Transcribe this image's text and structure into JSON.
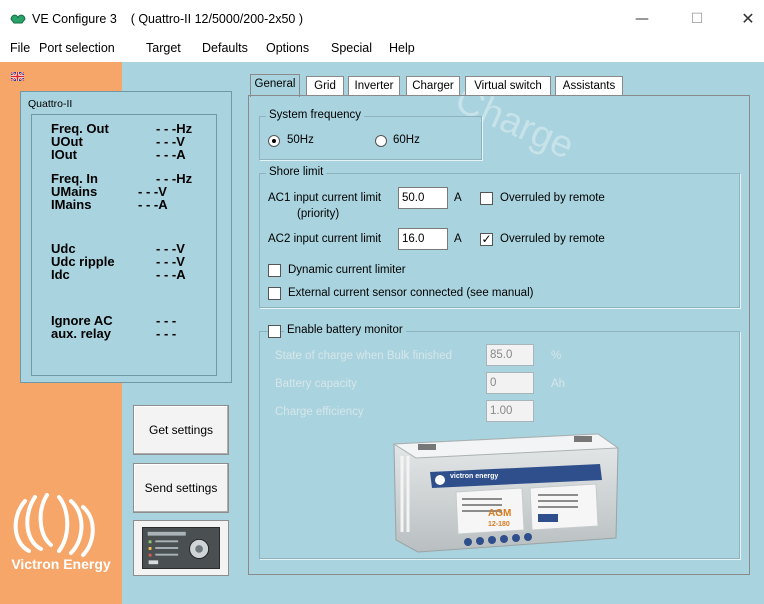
{
  "window": {
    "app_name": "VE Configure 3",
    "device_title": "( Quattro-II 12/5000/200-2x50 )",
    "min_symbol": "—",
    "max_symbol": "☐",
    "close_symbol": "✕"
  },
  "menu": [
    "File",
    "Port selection",
    "Target",
    "Defaults",
    "Options",
    "Special",
    "Help"
  ],
  "status": {
    "device": "Quattro-II",
    "rows": [
      {
        "label": "Freq. Out",
        "value": "- - -Hz"
      },
      {
        "label": "UOut",
        "value": "- - -V"
      },
      {
        "label": "IOut",
        "value": "- - -A"
      },
      {
        "label": "Freq. In",
        "value": "- - -Hz"
      },
      {
        "label": "UMains",
        "value": "- - -V"
      },
      {
        "label": "IMains",
        "value": "- - -A"
      },
      {
        "label": "Udc",
        "value": "- - -V"
      },
      {
        "label": "Udc ripple",
        "value": "- - -V"
      },
      {
        "label": "Idc",
        "value": "- - -A"
      },
      {
        "label": "Ignore AC",
        "value": "- - -"
      },
      {
        "label": "aux. relay",
        "value": "- - -"
      }
    ]
  },
  "buttons": {
    "get_settings": "Get settings",
    "send_settings": "Send settings"
  },
  "logo_text": "Victron Energy",
  "tabs": [
    "General",
    "Grid",
    "Inverter",
    "Charger",
    "Virtual switch",
    "Assistants"
  ],
  "active_tab": "General",
  "system_frequency": {
    "legend": "System frequency",
    "opt_50": "50Hz",
    "opt_60": "60Hz",
    "selected": "50Hz"
  },
  "shore_limit": {
    "legend": "Shore limit",
    "ac1_label": "AC1 input current limit",
    "ac1_sub": "(priority)",
    "ac1_value": "50.0",
    "ac1_unit": "A",
    "ac1_overruled_label": "Overruled by remote",
    "ac1_overruled": false,
    "ac2_label": "AC2 input current limit",
    "ac2_value": "16.0",
    "ac2_unit": "A",
    "ac2_overruled_label": "Overruled by remote",
    "ac2_overruled": true,
    "dynamic_limiter": "Dynamic current limiter",
    "external_sensor": "External current sensor connected (see manual)"
  },
  "battery_monitor": {
    "legend": "Enable battery monitor",
    "soc_label": "State of charge when Bulk finished",
    "soc_value": "85.0",
    "soc_unit": "%",
    "capacity_label": "Battery capacity",
    "capacity_value": "0",
    "capacity_unit": "Ah",
    "efficiency_label": "Charge efficiency",
    "efficiency_value": "1.00"
  },
  "battery_image": {
    "brand": "victron energy",
    "type": "AGM",
    "model": "12-180"
  },
  "watermark": "Charge"
}
